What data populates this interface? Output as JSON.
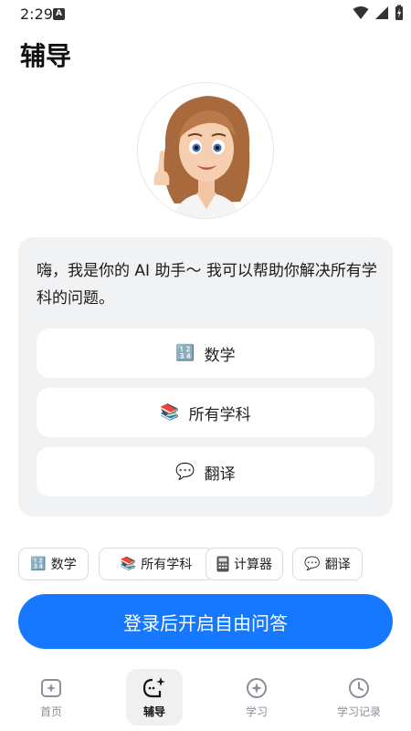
{
  "status_bar": {
    "time": "2:29",
    "notification_badge": "A"
  },
  "page": {
    "title": "辅导"
  },
  "chat": {
    "message": "嗨，我是你的 AI 助手～ 我可以帮助你解决所有学科的问题。",
    "options": [
      {
        "icon": "🔢",
        "label": "数学"
      },
      {
        "icon": "📚",
        "label": "所有学科"
      },
      {
        "icon": "💬",
        "label": "翻译"
      }
    ]
  },
  "chips": [
    {
      "icon": "🔢",
      "label": "数学"
    },
    {
      "icon": "📚",
      "label": "所有学科"
    },
    {
      "icon": "calculator-icon",
      "label": "计算器"
    },
    {
      "icon": "💬",
      "label": "翻译"
    }
  ],
  "login_button": {
    "label": "登录后开启自由问答"
  },
  "tabs": [
    {
      "label": "首页",
      "active": false
    },
    {
      "label": "辅导",
      "active": true
    },
    {
      "label": "学习",
      "active": false
    },
    {
      "label": "学习记录",
      "active": false
    }
  ],
  "colors": {
    "primary": "#1677ff",
    "card_bg": "#f1f2f4",
    "tab_inactive": "#8a8f99"
  }
}
